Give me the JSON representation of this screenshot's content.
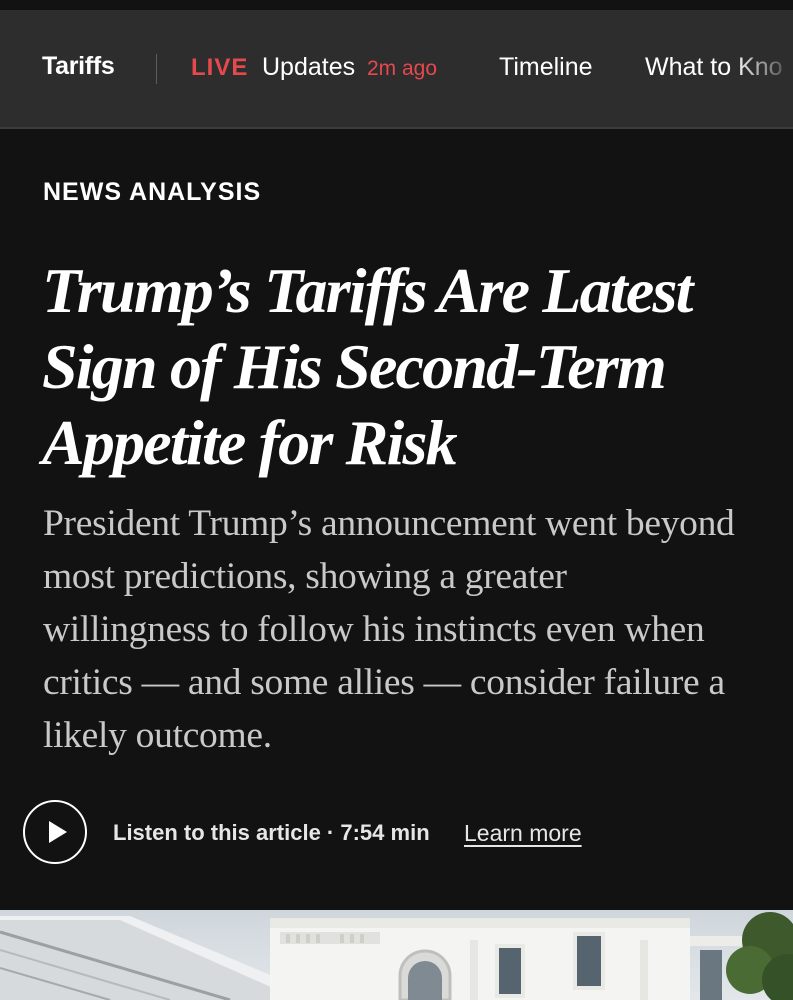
{
  "nav": {
    "section": "Tariffs",
    "live_label": "LIVE",
    "updates_label": "Updates",
    "updated_ago": "2m ago",
    "timeline_label": "Timeline",
    "what_to_know_label": "What to Kno"
  },
  "article": {
    "kicker": "NEWS ANALYSIS",
    "headline": "Trump’s Tariffs Are Latest Sign of His Second-Term Appetite for Risk",
    "summary": "President Trump’s announcement went beyond most predictions, showing a greater willingness to follow his instincts even when critics — and some allies — consider failure a likely outcome."
  },
  "audio": {
    "play_icon": "play-icon",
    "listen_label": "Listen to this article · 7:54 min",
    "learn_more_label": "Learn more"
  },
  "colors": {
    "background": "#121212",
    "nav_background": "#2d2d2d",
    "live_red": "#e5484d",
    "summary_text": "#c9c9c9"
  }
}
